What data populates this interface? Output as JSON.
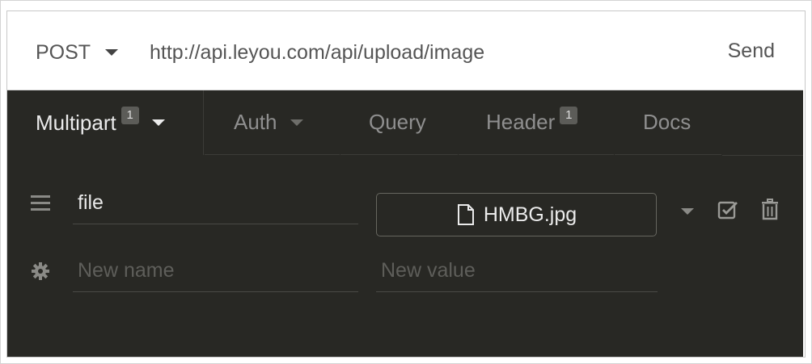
{
  "request": {
    "method": "POST",
    "url": "http://api.leyou.com/api/upload/image",
    "send_label": "Send"
  },
  "tabs": [
    {
      "label": "Multipart",
      "badge": "1"
    },
    {
      "label": "Auth"
    },
    {
      "label": "Query"
    },
    {
      "label": "Header",
      "badge": "1"
    },
    {
      "label": "Docs"
    }
  ],
  "params": {
    "row1": {
      "name": "file",
      "file_name": "HMBG.jpg"
    },
    "new_row": {
      "name_placeholder": "New name",
      "value_placeholder": "New value"
    }
  },
  "icons": {
    "drag": "drag-handle-icon",
    "settings": "gear-icon",
    "file": "file-icon",
    "checkbox": "checkbox-checked-icon",
    "delete": "trash-icon"
  },
  "colors": {
    "pane_bg": "#282824",
    "active_text": "#ebebeb",
    "inactive_text": "#8f8f8f"
  }
}
